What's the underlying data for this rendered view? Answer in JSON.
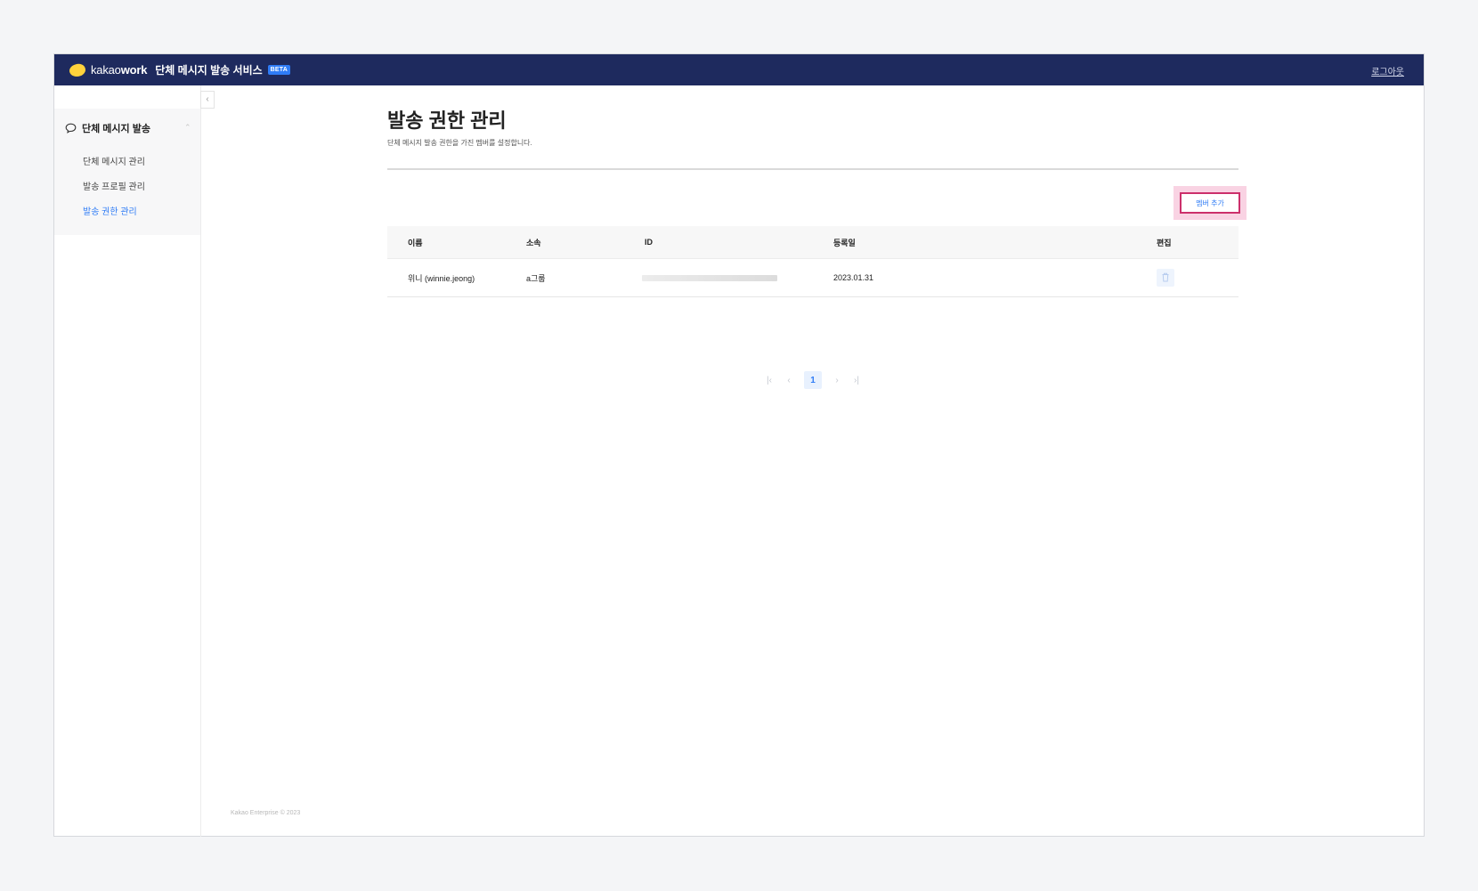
{
  "header": {
    "logo_text_light": "kakao",
    "logo_text_bold": "work",
    "service_title": "단체 메시지 발송 서비스",
    "beta_badge": "BETA",
    "logout": "로그아웃"
  },
  "sidebar": {
    "collapse_icon": "chevron-left-icon",
    "section_title": "단체 메시지 발송",
    "section_icon": "chat-bubble-icon",
    "items": [
      {
        "label": "단체 메시지 관리",
        "active": false
      },
      {
        "label": "발송 프로필 관리",
        "active": false
      },
      {
        "label": "발송 권한 관리",
        "active": true
      }
    ]
  },
  "main": {
    "title": "발송 권한 관리",
    "description": "단체 메시지 발송 권한을 가진 멤버를 설정합니다.",
    "add_member_button": "멤버 추가",
    "table": {
      "columns": [
        "이름",
        "소속",
        "ID",
        "등록일",
        "편집"
      ],
      "rows": [
        {
          "name": "위니 (winnie.jeong)",
          "group": "a그룹",
          "id": "",
          "registered": "2023.01.31",
          "edit_icon": "trash-icon"
        }
      ]
    },
    "pagination": {
      "current_page": "1",
      "icons": [
        "first-page-icon",
        "prev-page-icon",
        "next-page-icon",
        "last-page-icon"
      ]
    }
  },
  "footer": {
    "copyright": "Kakao Enterprise © 2023"
  },
  "colors": {
    "topbar": "#1e2a5e",
    "accent": "#2f7cf6",
    "highlight_border": "#cc2f6b",
    "highlight_bg": "#f9d3e3"
  }
}
